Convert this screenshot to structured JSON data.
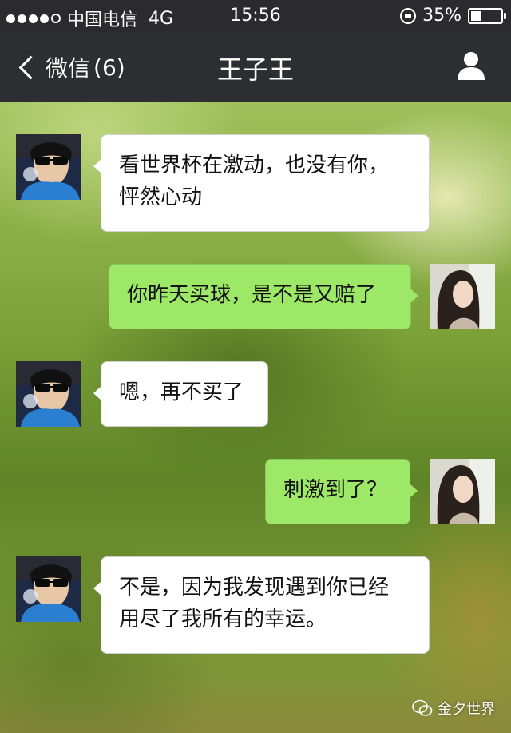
{
  "status_bar": {
    "carrier": "中国电信",
    "network": "4G",
    "time": "15:56",
    "battery_percent": "35%",
    "battery_level": 0.35,
    "signal_dots_filled": 4,
    "signal_dots_total": 5
  },
  "nav": {
    "back_label": "微信",
    "unread_count": "(6)",
    "title": "王子王",
    "profile_icon": "person-icon"
  },
  "messages": [
    {
      "side": "in",
      "line1": "看世界杯在激动，也没有你，",
      "line2": "怦然心动"
    },
    {
      "side": "out",
      "line1": "你昨天买球，是不是又赔了"
    },
    {
      "side": "in",
      "line1": "嗯，再不买了"
    },
    {
      "side": "out",
      "line1": "刺激到了？"
    },
    {
      "side": "in",
      "line1": "不是，因为我发现遇到你已经",
      "line2": "用尽了我所有的幸运。"
    }
  ],
  "watermark": {
    "text": "金夕世界"
  },
  "colors": {
    "navbar": "#2d2e32",
    "incoming_bubble": "#ffffff",
    "outgoing_bubble": "#9ee868"
  }
}
